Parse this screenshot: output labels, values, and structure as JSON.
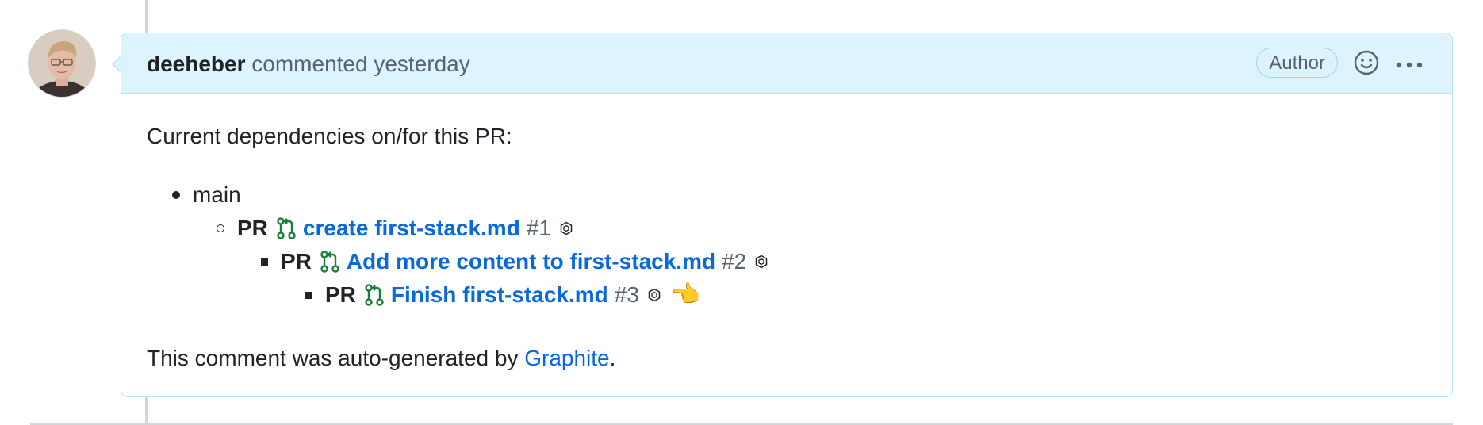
{
  "comment": {
    "author": "deeheber",
    "action": "commented",
    "time": "yesterday",
    "badge": "Author",
    "icons": {
      "reaction": "smiley-icon",
      "more": "kebab-horizontal-icon"
    },
    "intro": "Current dependencies on/for this PR:",
    "root_item": "main",
    "prs": [
      {
        "prefix": "PR",
        "title": "create first-stack.md",
        "number": "#1"
      },
      {
        "prefix": "PR",
        "title": "Add more content to first-stack.md",
        "number": "#2"
      },
      {
        "prefix": "PR",
        "title": "Finish first-stack.md",
        "number": "#3",
        "current_marker": "👈"
      }
    ],
    "footer_text": "This comment was auto-generated by",
    "footer_link": "Graphite",
    "footer_end": "."
  },
  "colors": {
    "link": "#0969da",
    "pr_open": "#1a7f37",
    "header_bg": "#ddf4ff",
    "border": "#b6e3ff"
  }
}
